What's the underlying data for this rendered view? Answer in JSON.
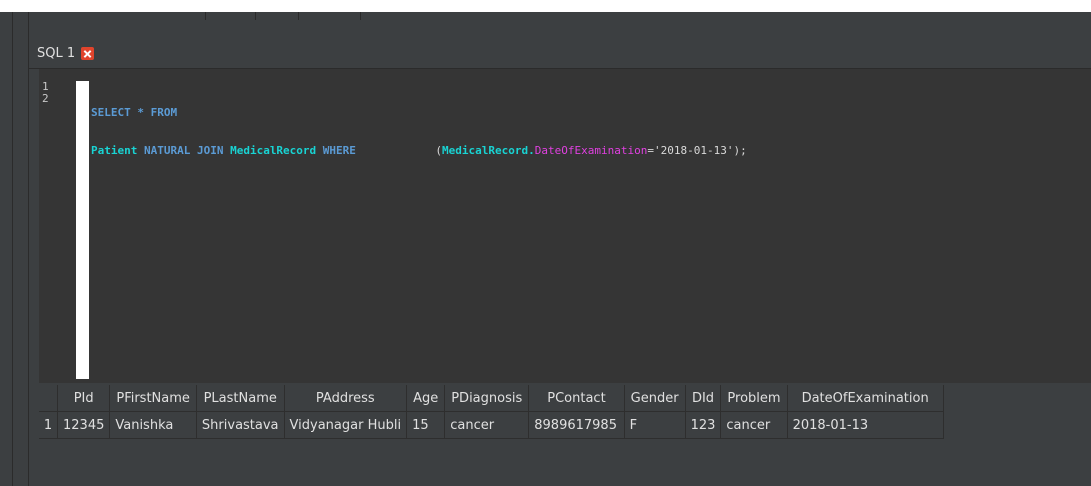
{
  "tab": {
    "label": "SQL 1"
  },
  "editor": {
    "line_numbers": [
      "1",
      "2"
    ],
    "line1": {
      "select": "SELECT",
      "star": " * ",
      "from": "FROM"
    },
    "line2": {
      "table1": "Patient",
      "natural_join": " NATURAL JOIN ",
      "table2": "MedicalRecord",
      "where": " WHERE",
      "spacing": "            ",
      "open_paren": "(",
      "qual_table": "MedicalRecord",
      "dot": ".",
      "column": "DateOfExamination",
      "eq": "=",
      "value": "'2018-01-13'",
      "close": ");"
    }
  },
  "results": {
    "columns": [
      "PId",
      "PFirstName",
      "PLastName",
      "PAddress",
      "Age",
      "PDiagnosis",
      "PContact",
      "Gender",
      "DId",
      "Problem",
      "DateOfExamination"
    ],
    "rows": [
      {
        "index": "1",
        "cells": [
          "12345",
          "Vanishka",
          "Shrivastava",
          "Vidyanagar Hubli",
          "15",
          "cancer",
          "8989617985",
          "F",
          "123",
          "cancer",
          "2018-01-13"
        ]
      }
    ]
  }
}
